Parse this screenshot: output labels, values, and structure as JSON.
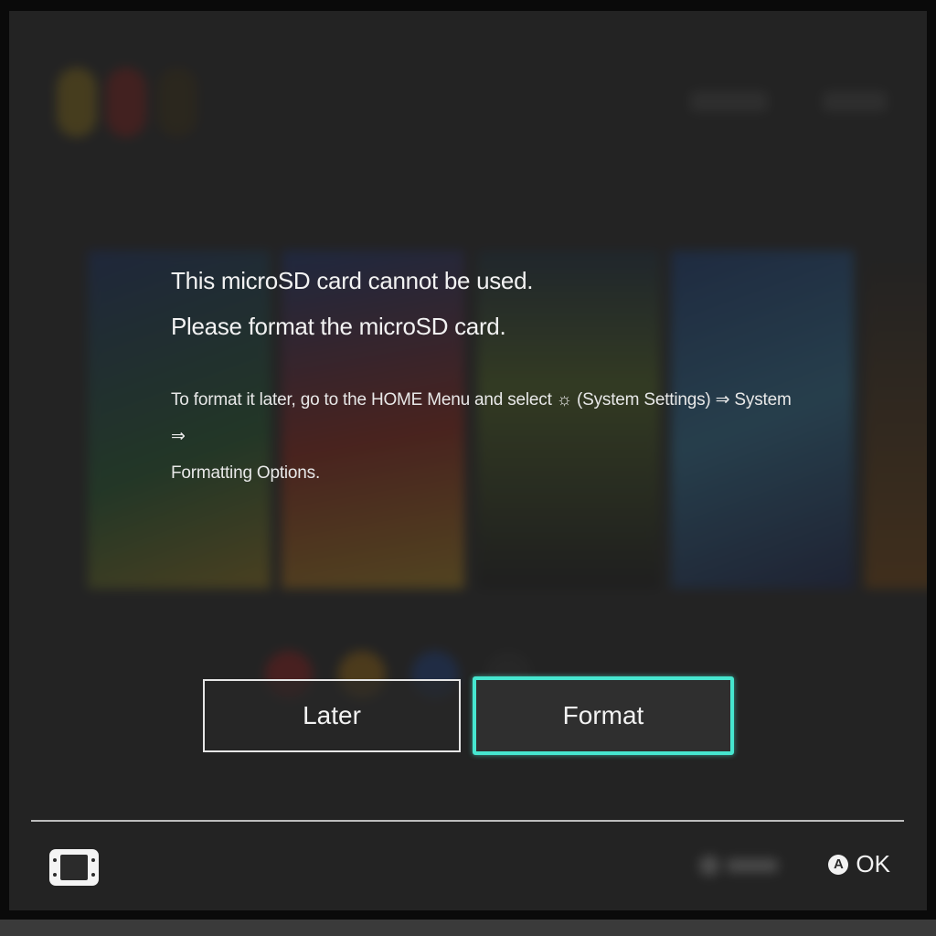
{
  "dialog": {
    "message_line1": "This microSD card cannot be used.",
    "message_line2": "Please format the microSD card.",
    "info_line1": "To format it later, go to the HOME Menu and select ☼ (System Settings) ⇒ System ⇒",
    "info_line2": "Formatting Options."
  },
  "buttons": {
    "later_label": "Later",
    "format_label": "Format"
  },
  "footer": {
    "ok_button_glyph": "A",
    "ok_label": "OK"
  },
  "colors": {
    "accent_focus": "#46e6cf",
    "background": "#2b2b2b",
    "text": "#f2f2f2"
  },
  "icons": {
    "bottom_left": "handheld-console-icon",
    "ok": "a-button-icon"
  }
}
